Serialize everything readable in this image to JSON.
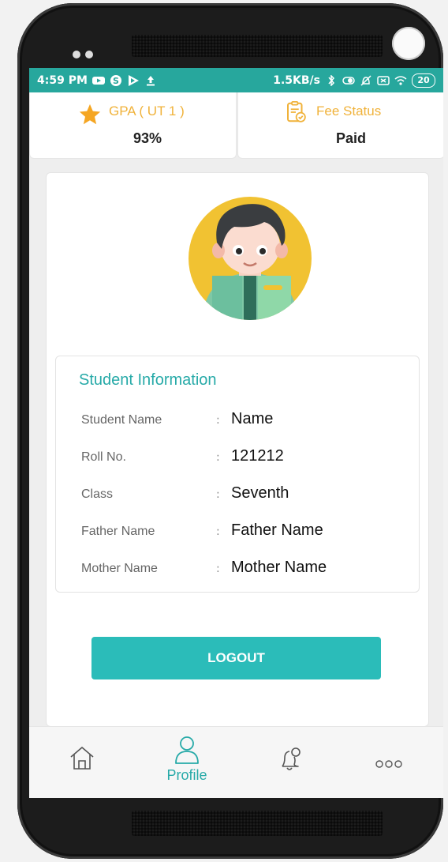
{
  "statusbar": {
    "time": "4:59 PM",
    "net_speed": "1.5KB/s",
    "battery": "20"
  },
  "stats": {
    "gpa_title": "GPA ( UT 1 )",
    "gpa_value": "93%",
    "fee_title": "Fee Status",
    "fee_value": "Paid"
  },
  "student_info": {
    "heading": "Student Information",
    "separator": ":",
    "rows": [
      {
        "label": "Student Name",
        "value": "Name"
      },
      {
        "label": "Roll No.",
        "value": "121212"
      },
      {
        "label": "Class",
        "value": "Seventh"
      },
      {
        "label": "Father Name",
        "value": "Father Name"
      },
      {
        "label": "Mother Name",
        "value": "Mother Name"
      }
    ]
  },
  "actions": {
    "logout_label": "LOGOUT"
  },
  "nav": {
    "items": [
      {
        "icon": "home-icon"
      },
      {
        "icon": "user-icon",
        "label": "Profile",
        "active": true
      },
      {
        "icon": "bell-icon"
      },
      {
        "icon": "more-icon"
      }
    ]
  },
  "colors": {
    "accent": "#27aaa8",
    "statusbar": "#27a79d",
    "gold": "#f0b23a",
    "button": "#2bbcb9"
  }
}
